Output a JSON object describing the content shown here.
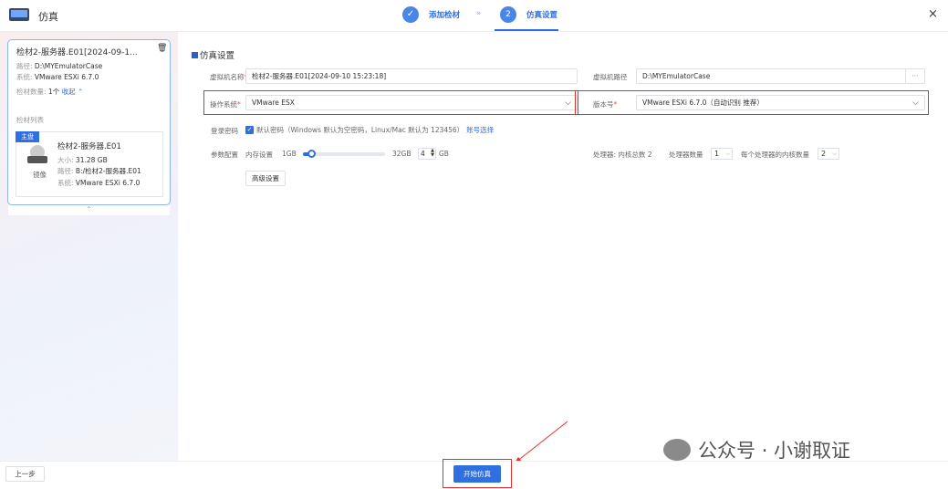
{
  "header": {
    "title": "仿真",
    "steps": [
      {
        "num": "✓",
        "label": "添加检材"
      },
      {
        "num": "2",
        "label": "仿真设置"
      }
    ],
    "separator": "»",
    "close": "×"
  },
  "sidebar": {
    "card": {
      "title": "检材2-服务器.E01[2024-09-1...",
      "path_label": "路径:",
      "path": "D:\\MYEmulatorCase",
      "os_label": "系统:",
      "os": "VMware ESXi 6.7.0",
      "count_label": "检材数量:",
      "count": "1个",
      "collapse": "收起 ⌃",
      "list_label": "检材列表",
      "item": {
        "badge": "主盘",
        "name": "检材2-服务器.E01",
        "type": "镜像",
        "size_label": "大小:",
        "size": "31.28 GB",
        "path_label": "路径:",
        "path": "B:/检材2-服务器.E01",
        "os_label": "系统:",
        "os": "VMware ESXi 6.7.0"
      }
    }
  },
  "main": {
    "section_title": "仿真设置",
    "vm_name_label": "虚拟机名称",
    "vm_name": "检材2-服务器.E01[2024-09-10 15:23:18]",
    "vm_path_label": "虚拟机路径",
    "vm_path": "D:\\MYEmulatorCase",
    "browse": "···",
    "os_label": "操作系统",
    "os": "VMware ESX",
    "version_label": "版本号",
    "version": "VMware ESXi 6.7.0（自动识别 推荐）",
    "password_label": "登录密码",
    "password_option": "默认密码（Windows 默认为空密码，Linux/Mac 默认为 123456）",
    "password_link": "账号选择",
    "params_label": "参数配置",
    "memory_label": "内存设置",
    "mem_min": "1GB",
    "mem_max": "32GB",
    "mem_value": "4",
    "mem_unit": "GB",
    "mem_fraction": 0.1,
    "cpu_cores_text": "处理器: 内核总数 2",
    "cpu_count_label": "处理器数量",
    "cpu_count": "1",
    "cores_per_label": "每个处理器的内核数量",
    "cores_per": "2",
    "advanced": "高级设置"
  },
  "footer": {
    "prev": "上一步",
    "start": "开始仿真"
  },
  "watermark": "公众号 · 小谢取证",
  "colors": {
    "accent": "#2f6fe0",
    "highlight": "#e0312f"
  }
}
